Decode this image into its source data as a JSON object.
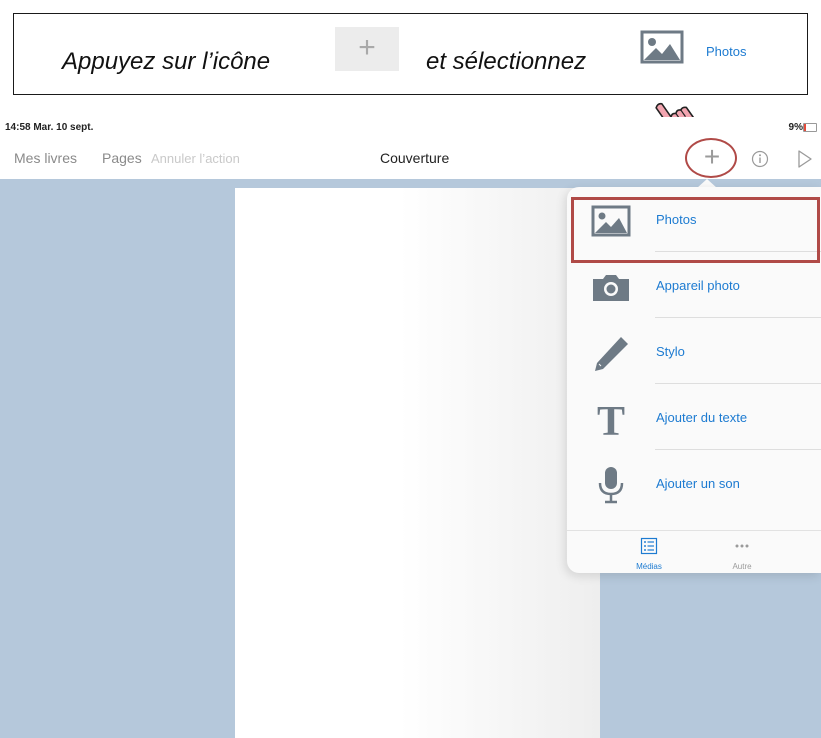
{
  "banner": {
    "text_before": "Appuyez sur l’icône",
    "plus_symbol": "+",
    "text_after": "et sélectionnez",
    "photos_label": "Photos"
  },
  "status": {
    "time": "14:58  Mar. 10 sept.",
    "battery": "9%"
  },
  "toolbar": {
    "my_books": "Mes livres",
    "pages": "Pages",
    "undo": "Annuler l’action",
    "title": "Couverture",
    "add": "+"
  },
  "menu": {
    "items": [
      {
        "label": "Photos",
        "icon": "photos-icon"
      },
      {
        "label": "Appareil photo",
        "icon": "camera-icon"
      },
      {
        "label": "Stylo",
        "icon": "pen-icon"
      },
      {
        "label": "Ajouter du texte",
        "icon": "text-icon"
      },
      {
        "label": "Ajouter un son",
        "icon": "microphone-icon"
      }
    ],
    "tabs": [
      {
        "label": "Médias",
        "icon": "list-icon",
        "active": true
      },
      {
        "label": "Autre",
        "icon": "more-icon",
        "active": false
      }
    ]
  },
  "colors": {
    "accent": "#1d7bd1",
    "highlight": "#b04a47",
    "canvas": "#b5c8db"
  }
}
